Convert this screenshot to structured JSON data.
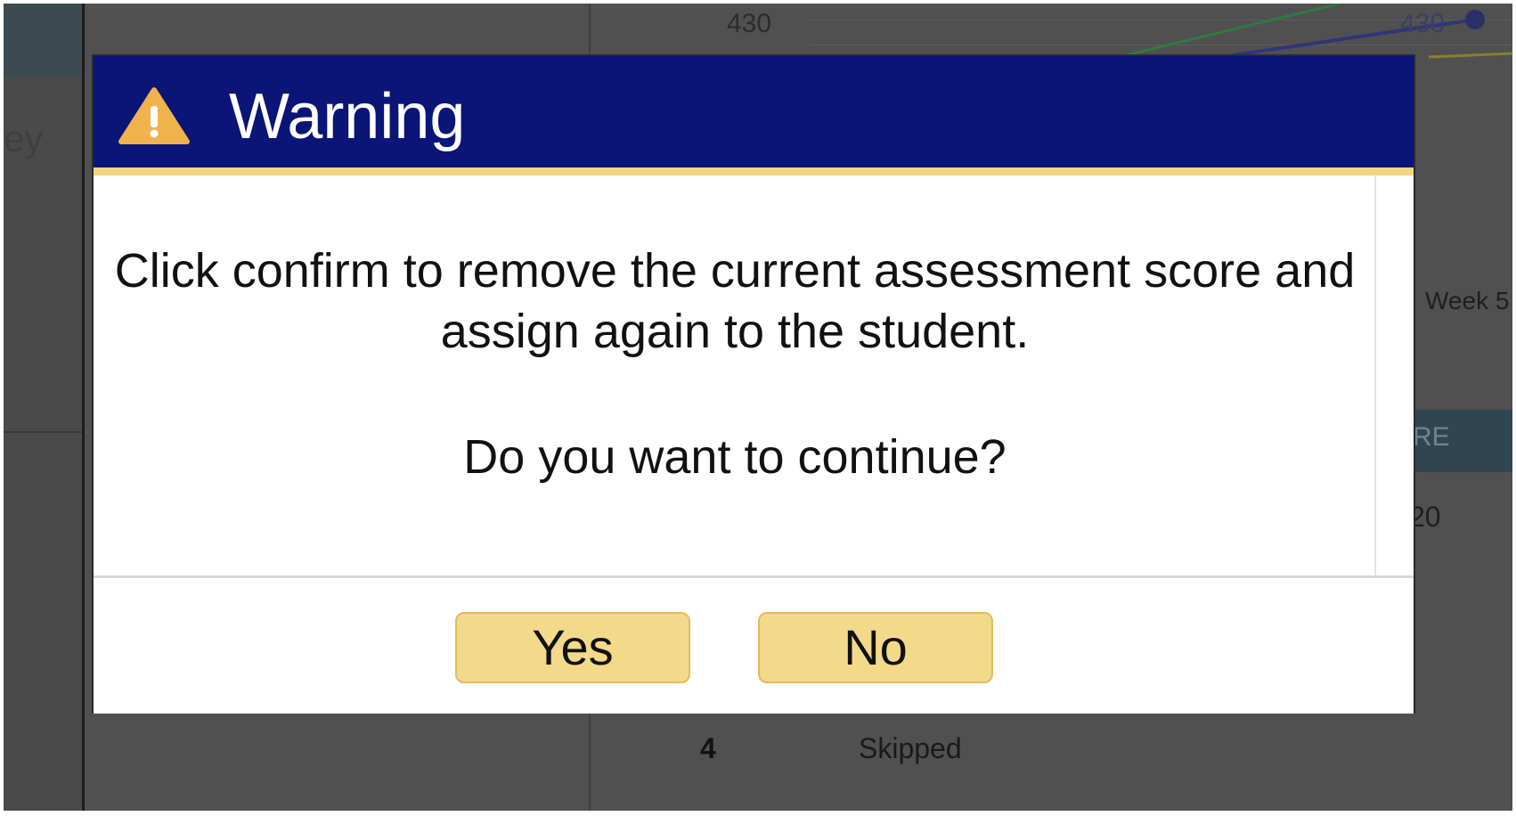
{
  "background": {
    "partial_text": "ey",
    "axis_tick": "430",
    "point_label": "430",
    "week_label": "Week 5",
    "header_fragment": "RE",
    "value_fragment": "20",
    "table_row": {
      "number": "4",
      "status": "Skipped"
    }
  },
  "dialog": {
    "title": "Warning",
    "icon": "warning-triangle-icon",
    "message_line1": "Click confirm to remove the current assessment score and assign again to the student.",
    "message_line2": "Do you want to continue?",
    "yes_label": "Yes",
    "no_label": "No",
    "colors": {
      "header_bg": "#0a1577",
      "accent_stripe": "#f2d57c",
      "button_bg": "#f3d98a",
      "icon": "#f0b24c"
    }
  }
}
